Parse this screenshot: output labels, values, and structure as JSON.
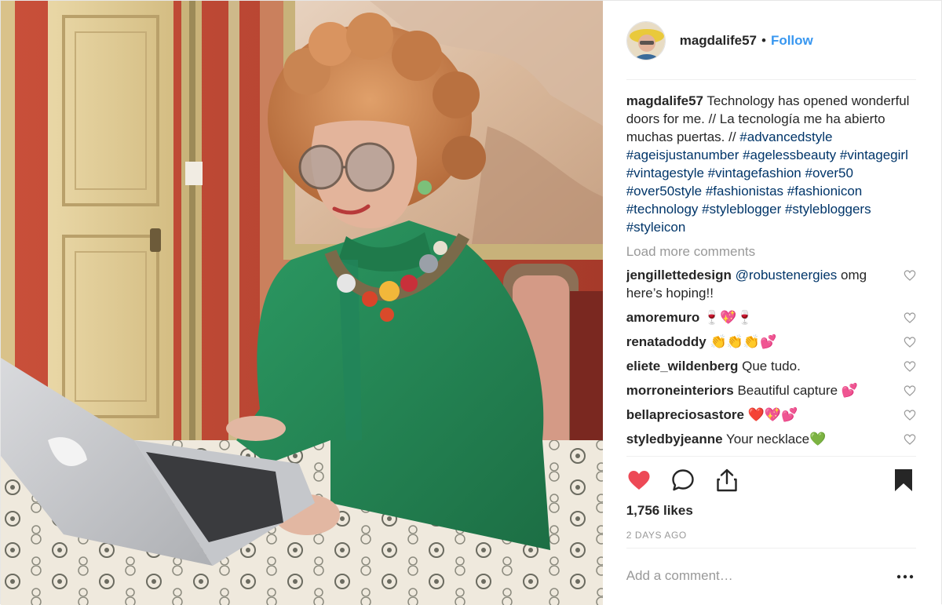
{
  "post": {
    "username": "magdalife57",
    "separator": "•",
    "follow_label": "Follow",
    "caption": {
      "username": "magdalife57",
      "text": "Technology has opened wonderful doors for me. // La tecnología me ha abierto muchas puertas. //",
      "hashtags": "#advancedstyle #ageisjustanumber #agelessbeauty #vintagegirl #vintagestyle #vintagefashion #over50 #over50style #fashionistas #fashionicon #technology #styleblogger #stylebloggers #styleicon"
    },
    "load_more_label": "Load more comments",
    "comments": [
      {
        "username": "jengillettedesign",
        "mention": "@robustenergies",
        "text": "omg here’s hoping!!"
      },
      {
        "username": "amoremuro",
        "mention": "",
        "text": "🍷💖🍷"
      },
      {
        "username": "renatadoddy",
        "mention": "",
        "text": "👏👏👏💕"
      },
      {
        "username": "eliete_wildenberg",
        "mention": "",
        "text": "Que tudo."
      },
      {
        "username": "morroneinteriors",
        "mention": "",
        "text": "Beautiful capture 💕"
      },
      {
        "username": "bellapreciosastore",
        "mention": "",
        "text": "❤️💖💕"
      },
      {
        "username": "styledbyjeanne",
        "mention": "",
        "text": "Your necklace💚"
      }
    ],
    "likes": "1,756 likes",
    "timestamp": "2 DAYS AGO",
    "add_comment_placeholder": "Add a comment…",
    "more_label": "…"
  },
  "icons": {
    "like": "heart-filled-icon",
    "comment": "speech-bubble-icon",
    "share": "share-upload-icon",
    "save": "bookmark-filled-icon",
    "comment_like": "heart-outline-icon",
    "more": "ellipsis-icon"
  },
  "colors": {
    "accent": "#3897f0",
    "hashtag": "#003569",
    "like_red": "#ed4956",
    "muted": "#999999",
    "text": "#262626"
  }
}
